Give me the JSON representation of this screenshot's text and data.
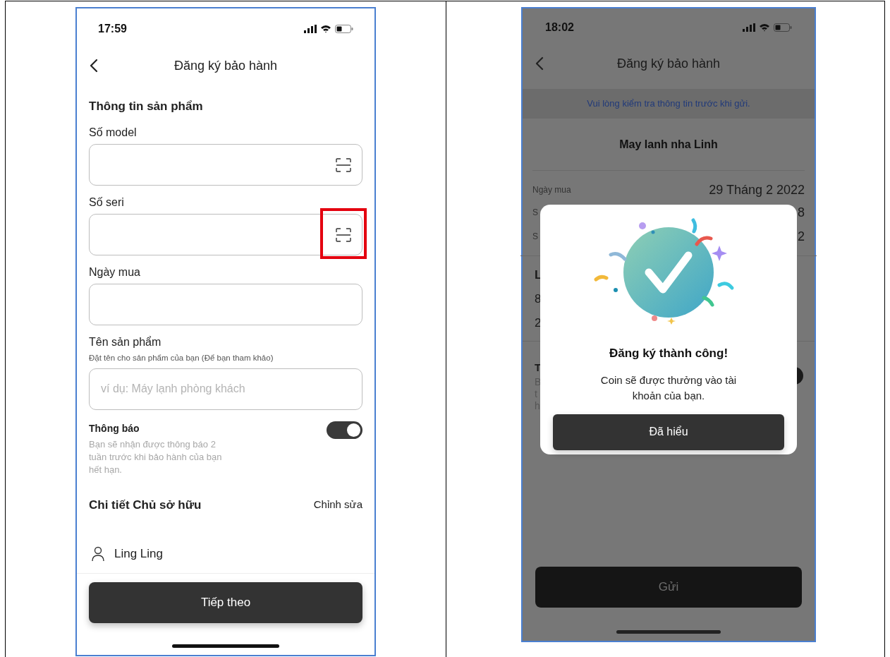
{
  "left_screen": {
    "status_time": "17:59",
    "header_title": "Đăng ký bảo hành",
    "section_title": "Thông tin sản phẩm",
    "fields": [
      {
        "label": "Số model",
        "scan_button": true,
        "highlighted": false
      },
      {
        "label": "Số seri",
        "scan_button": true,
        "highlighted": true
      },
      {
        "label": "Ngày mua",
        "scan_button": false,
        "highlighted": false
      },
      {
        "label": "Tên sản phẩm",
        "hint": "Đặt tên cho sản phẩm của bạn (Để bạn tham khảo)",
        "placeholder": "ví dụ: Máy lạnh phòng khách",
        "scan_button": false,
        "highlighted": false
      }
    ],
    "notification": {
      "title": "Thông báo",
      "description": "Bạn sẽ nhận được thông báo 2 tuần trước khi bảo hành của bạn hết hạn.",
      "on": true
    },
    "owner": {
      "title": "Chi tiết Chủ sở hữu",
      "edit_link": "Chỉnh sửa",
      "name": "Ling Ling"
    },
    "next_button": "Tiếp theo"
  },
  "right_screen": {
    "status_time": "18:02",
    "header_title": "Đăng ký bảo hành",
    "notice": "Vui lòng kiểm tra thông tin trước khi gửi.",
    "product_name": "May lanh nha Linh",
    "details": [
      {
        "label": "Ngày mua",
        "value": "29 Tháng 2 2022"
      },
      {
        "label": "S",
        "value": "8"
      },
      {
        "label": "S",
        "value": "2"
      }
    ],
    "address_lines": [
      "L",
      "8",
      "2"
    ],
    "notification": {
      "title": "T",
      "description_lines": [
        "B",
        "t",
        "h"
      ],
      "on": true
    },
    "submit_button": "Gửi",
    "dialog": {
      "title": "Đăng ký thành công!",
      "message": "Coin sẽ được thưởng vào tài khoản của bạn.",
      "button": "Đã hiểu"
    }
  }
}
